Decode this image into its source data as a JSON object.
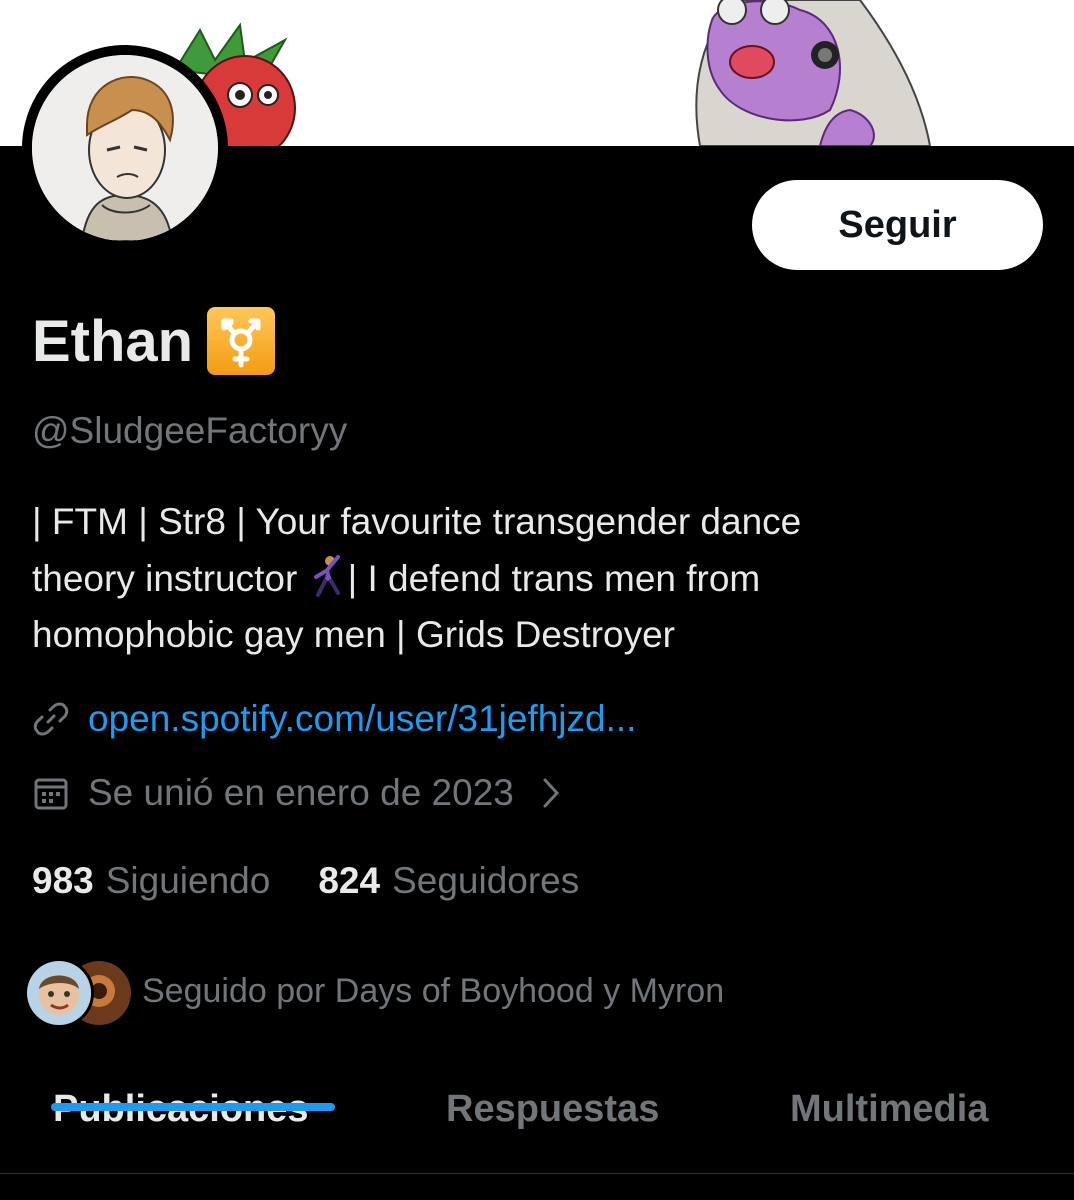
{
  "profile": {
    "name": "Ethan",
    "name_badge_icon": "transgender-symbol-icon",
    "handle": "@SludgeeFactoryy",
    "follow_button": "Seguir",
    "bio": {
      "line1": "| FTM | Str8 | Your favourite transgender dance",
      "line2a": "theory instructor ",
      "line2_icon": "man-dancing-emoji",
      "line2b": "| I defend trans men from",
      "line3": "homophobic gay men | Grids Destroyer"
    },
    "link": "open.spotify.com/user/31jefhjzd...",
    "joined": "Se unió en enero de 2023",
    "following_count": "983",
    "following_label": "Siguiendo",
    "followers_count": "824",
    "followers_label": "Seguidores",
    "followed_by": "Seguido por Days of Boyhood y Myron"
  },
  "tabs": [
    {
      "label": "Publicaciones",
      "active": true
    },
    {
      "label": "Respuestas",
      "active": false
    },
    {
      "label": "Multimedia",
      "active": false
    }
  ],
  "colors": {
    "background": "#000000",
    "text_primary": "#e7e9ea",
    "text_secondary": "#71767b",
    "accent": "#1d9bf0",
    "button_bg": "#ffffff"
  }
}
